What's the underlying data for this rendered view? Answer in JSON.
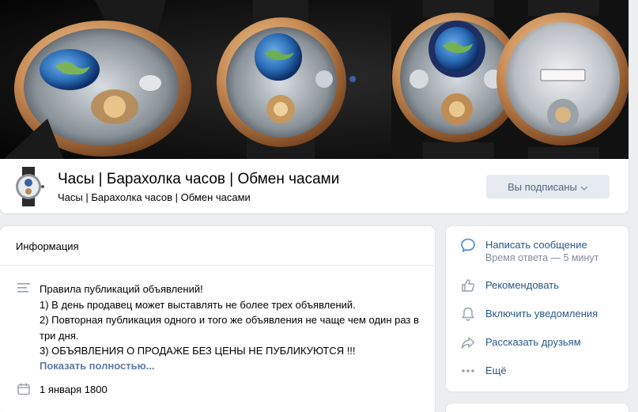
{
  "header": {
    "cover_alt": "watch-cover-banner",
    "group_name": "Часы | Барахолка часов | Обмен часами",
    "group_status": "Часы | Барахолка часов | Обмен часами",
    "subscribed_label": "Вы подписаны",
    "accent_bg": "#e5ebf1"
  },
  "info": {
    "title": "Информация",
    "description_lines": [
      "Правила публикаций объявлений!",
      "1) В день продавец может выставлять не более трех объявлений.",
      "2) Повторная публикация одного и того же объявления не чаще чем один раз в три дня.",
      "3) ОБЪЯВЛЕНИЯ О ПРОДАЖЕ БЕЗ ЦЕНЫ НЕ ПУБЛИКУЮТСЯ !!!"
    ],
    "show_more": "Показать полностью...",
    "date": "1 января 1800"
  },
  "actions": {
    "message": "Написать сообщение",
    "response_time": "Время ответа — 5 минут",
    "recommend": "Рекомендовать",
    "notifications": "Включить уведомления",
    "share": "Рассказать друзьям",
    "more": "Ещё"
  },
  "icons": {
    "message": "message-bubble-icon",
    "recommend": "thumb-up-icon",
    "notifications": "bell-icon",
    "share": "share-arrow-icon",
    "more": "more-dots-icon",
    "description": "text-lines-icon",
    "date": "calendar-icon"
  },
  "colors": {
    "link": "#2a5885",
    "muted": "#818c99",
    "show_more": "#5b7aa0"
  }
}
